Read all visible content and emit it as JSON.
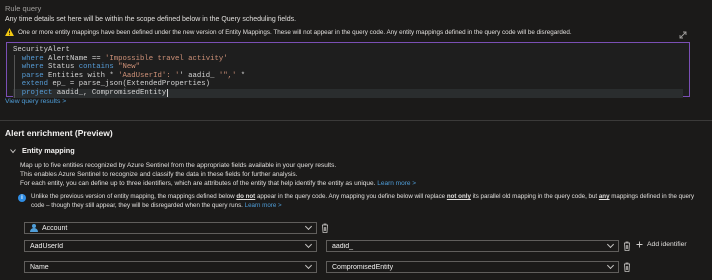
{
  "header": {
    "title": "Rule query",
    "description": "Any time details set here will be within the scope defined below in the Query scheduling fields."
  },
  "warning": {
    "text": "One or more entity mappings have been defined under the new version of Entity Mappings. These will not appear in the query code. Any entity mappings defined in the query code will be disregarded."
  },
  "editor": {
    "lines": [
      {
        "parts": [
          {
            "t": "SecurityAlert",
            "c": ""
          }
        ]
      },
      {
        "parts": [
          {
            "t": "where ",
            "c": "kw"
          },
          {
            "t": "AlertName == ",
            "c": ""
          },
          {
            "t": "'Impossible travel activity'",
            "c": "str"
          }
        ]
      },
      {
        "parts": [
          {
            "t": "where ",
            "c": "kw"
          },
          {
            "t": "Status ",
            "c": ""
          },
          {
            "t": "contains ",
            "c": "kw"
          },
          {
            "t": "\"New\"",
            "c": "str"
          }
        ]
      },
      {
        "parts": [
          {
            "t": "parse ",
            "c": "kw"
          },
          {
            "t": "Entities with * ",
            "c": ""
          },
          {
            "t": "'AadUserId': '",
            "c": "str"
          },
          {
            "t": "' aadid_ ",
            "c": ""
          },
          {
            "t": "'\",'",
            "c": "str"
          },
          {
            "t": " *",
            "c": ""
          }
        ]
      },
      {
        "parts": [
          {
            "t": "extend ",
            "c": "kw"
          },
          {
            "t": "ep_ = parse_json(ExtendedProperties)",
            "c": ""
          }
        ]
      },
      {
        "parts": [
          {
            "t": "project ",
            "c": "kw"
          },
          {
            "t": "aadid_, CompromisedEntity",
            "c": ""
          }
        ]
      }
    ]
  },
  "view_results_link": "View query results >",
  "enrichment": {
    "title": "Alert enrichment (Preview)",
    "entity_mapping": {
      "label": "Entity mapping",
      "desc_line1": "Map up to five entities recognized by Azure Sentinel from the appropriate fields available in your query results.",
      "desc_line2": "This enables Azure Sentinel to recognize and classify the data in these fields for further analysis.",
      "desc_line3": "For each entity, you can define up to three identifiers, which are attributes of the entity that help identify the entity as unique.",
      "learn_more": "Learn more >",
      "info": {
        "part1": "Unlike the previous version of entity mapping, the mappings defined below ",
        "bold1": "do not",
        "part2": " appear in the query code. Any mapping you define below will replace ",
        "bold2": "not only",
        "part3": " its parallel old mapping in the query code, but ",
        "bold3": "any",
        "part4": " mappings defined in the query",
        "line2": "code – though they still appear, they will be disregarded when the query runs.",
        "learn_more": "Learn more >"
      },
      "entity_type": "Account",
      "identifiers": [
        {
          "identifier": "AadUserId",
          "value": "aadid_"
        },
        {
          "identifier": "Name",
          "value": "CompromisedEntity"
        }
      ],
      "add_identifier": "Add identifier"
    }
  },
  "icons": {
    "warning": "warning-icon",
    "expand": "expand-icon",
    "info": "info-icon",
    "delete": "trash-icon",
    "account": "person-icon",
    "add": "plus-icon"
  },
  "colors": {
    "background": "#1b1a19",
    "accent_link": "#4f9ed9",
    "editor_border": "#7a4fb5",
    "warning": "#f2c811"
  }
}
